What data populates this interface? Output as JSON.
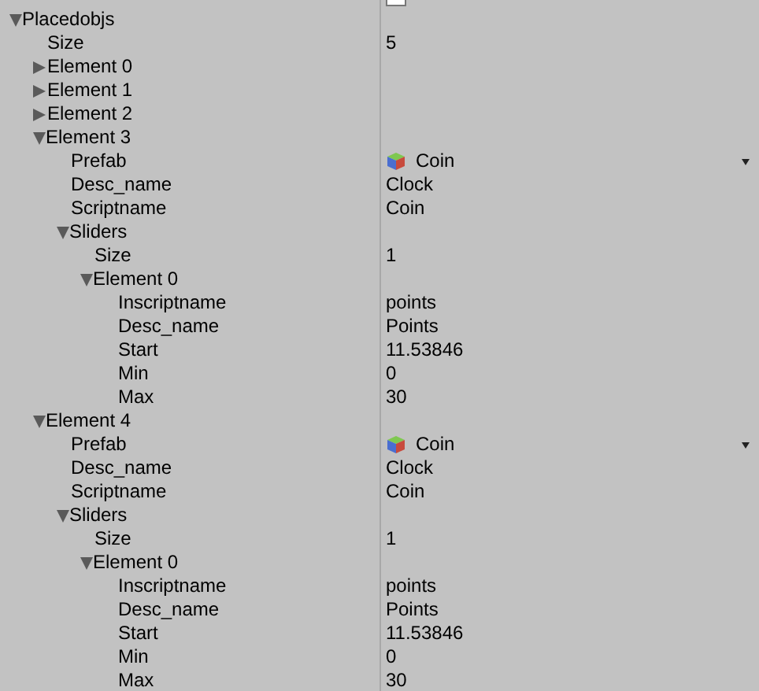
{
  "rows": [
    {
      "kind": "script_field"
    },
    {
      "kind": "foldout",
      "label": "Placedobjs",
      "expanded": true,
      "children": [
        {
          "kind": "text",
          "label": "Size",
          "value": "5"
        },
        {
          "kind": "foldout",
          "label": "Element 0",
          "expanded": false
        },
        {
          "kind": "foldout",
          "label": "Element 1",
          "expanded": false
        },
        {
          "kind": "foldout",
          "label": "Element 2",
          "expanded": false
        },
        {
          "kind": "foldout",
          "label": "Element 3",
          "expanded": true,
          "children": [
            {
              "kind": "prefab_field",
              "label": "Prefab",
              "value": "Coin"
            },
            {
              "kind": "text",
              "label": "Desc_name",
              "value": "Clock"
            },
            {
              "kind": "text",
              "label": "Scriptname",
              "value": "Coin"
            },
            {
              "kind": "foldout",
              "label": "Sliders",
              "expanded": true,
              "children": [
                {
                  "kind": "text",
                  "label": "Size",
                  "value": "1"
                },
                {
                  "kind": "foldout",
                  "label": "Element 0",
                  "expanded": true,
                  "children": [
                    {
                      "kind": "text",
                      "label": "Inscriptname",
                      "value": "points"
                    },
                    {
                      "kind": "text",
                      "label": "Desc_name",
                      "value": "Points"
                    },
                    {
                      "kind": "text",
                      "label": "Start",
                      "value": "11.53846"
                    },
                    {
                      "kind": "text",
                      "label": "Min",
                      "value": "0"
                    },
                    {
                      "kind": "text",
                      "label": "Max",
                      "value": "30"
                    }
                  ]
                }
              ]
            }
          ]
        },
        {
          "kind": "foldout",
          "label": "Element 4",
          "expanded": true,
          "children": [
            {
              "kind": "prefab_field",
              "label": "Prefab",
              "value": "Coin"
            },
            {
              "kind": "text",
              "label": "Desc_name",
              "value": "Clock"
            },
            {
              "kind": "text",
              "label": "Scriptname",
              "value": "Coin"
            },
            {
              "kind": "foldout",
              "label": "Sliders",
              "expanded": true,
              "children": [
                {
                  "kind": "text",
                  "label": "Size",
                  "value": "1"
                },
                {
                  "kind": "foldout",
                  "label": "Element 0",
                  "expanded": true,
                  "children": [
                    {
                      "kind": "text",
                      "label": "Inscriptname",
                      "value": "points"
                    },
                    {
                      "kind": "text",
                      "label": "Desc_name",
                      "value": "Points"
                    },
                    {
                      "kind": "text",
                      "label": "Start",
                      "value": "11.53846"
                    },
                    {
                      "kind": "text",
                      "label": "Min",
                      "value": "0"
                    },
                    {
                      "kind": "text",
                      "label": "Max",
                      "value": "30"
                    }
                  ]
                }
              ]
            }
          ]
        }
      ]
    }
  ]
}
